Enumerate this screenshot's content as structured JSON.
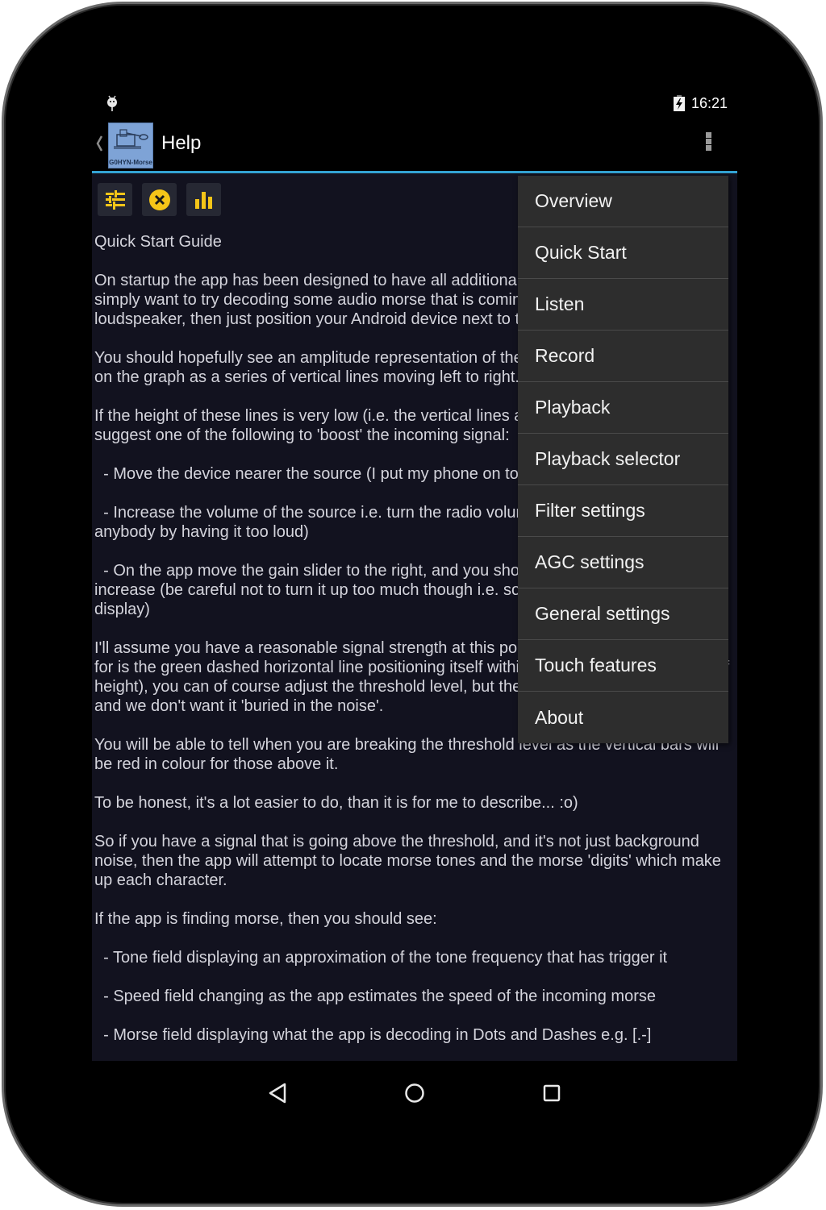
{
  "status_bar": {
    "notification_icon": "android-debug-icon",
    "battery_icon": "battery-charging-icon",
    "time": "16:21"
  },
  "action_bar": {
    "up_icon": "chevron-left-icon",
    "app_logo_text": "G0HYN-Morse",
    "title": "Help",
    "overflow_icon": "more-vertical-icon"
  },
  "toolbar": {
    "buttons": [
      {
        "name": "settings-sliders",
        "icon": "sliders-icon"
      },
      {
        "name": "close",
        "icon": "close-circle-icon"
      },
      {
        "name": "chart",
        "icon": "bar-chart-icon"
      }
    ],
    "accent_color": "#f5c518"
  },
  "content": {
    "heading": "Quick Start Guide",
    "paragraphs": [
      "On startup the app has been designed to have all additional features turned off, so if you simply want to try decoding some audio morse that is coming out of a radio/computer loudspeaker, then just position your Android device next to the speaker.",
      "You should hopefully see an amplitude representation of the incoming audio being drawn on the graph as a series of vertical lines moving left to right.",
      "If the height of these lines is very low (i.e. the vertical lines are very short) then I would suggest one of the following to 'boost' the incoming signal:",
      "  - Move the device nearer the source (I put my phone on top of the speaker)",
      "  - Increase the volume of the source i.e. turn the radio volume up (but try not to annoy anybody by having it too loud)",
      "  - On the app move the gain slider to the right, and you should see the vertical lines increase (be careful not to turn it up too much though i.e. so the lines hit the top of the display)",
      "I'll assume you have a reasonable signal strength at this point, so the next thing to look for is the green dashed horizontal line positioning itself within the vertical lines (about half height), you can of course adjust the threshold level, but the app does this automatically and we don't want it 'buried in the noise'.",
      "You will be able to tell when you are breaking the threshold level as the vertical bars will be red in colour for those above it.",
      "To be honest, it's a lot easier to do, than it is for me to describe... :o)",
      "So if you have a signal that is going above the threshold, and it's not just background noise, then the app will attempt to locate morse tones and the morse 'digits' which make up each character.",
      "If the app is finding morse, then you should see:",
      "  - Tone field displaying an approximation of the tone frequency that has trigger it",
      "  - Speed field changing as the app estimates the speed of the incoming morse",
      "  - Morse field displaying what the app is decoding in Dots and Dashes e.g. [.-]"
    ]
  },
  "overflow_menu": {
    "items": [
      "Overview",
      "Quick Start",
      "Listen",
      "Record",
      "Playback",
      "Playback selector",
      "Filter settings",
      "AGC settings",
      "General settings",
      "Touch features",
      "About"
    ]
  },
  "nav_bar": {
    "back_icon": "back-triangle-icon",
    "home_icon": "home-circle-icon",
    "recents_icon": "recents-square-icon"
  },
  "colors": {
    "accent_blue": "#33a3d3",
    "content_bg": "#12121f",
    "menu_bg": "#2d2d2d",
    "icon_yellow": "#f5c518"
  }
}
